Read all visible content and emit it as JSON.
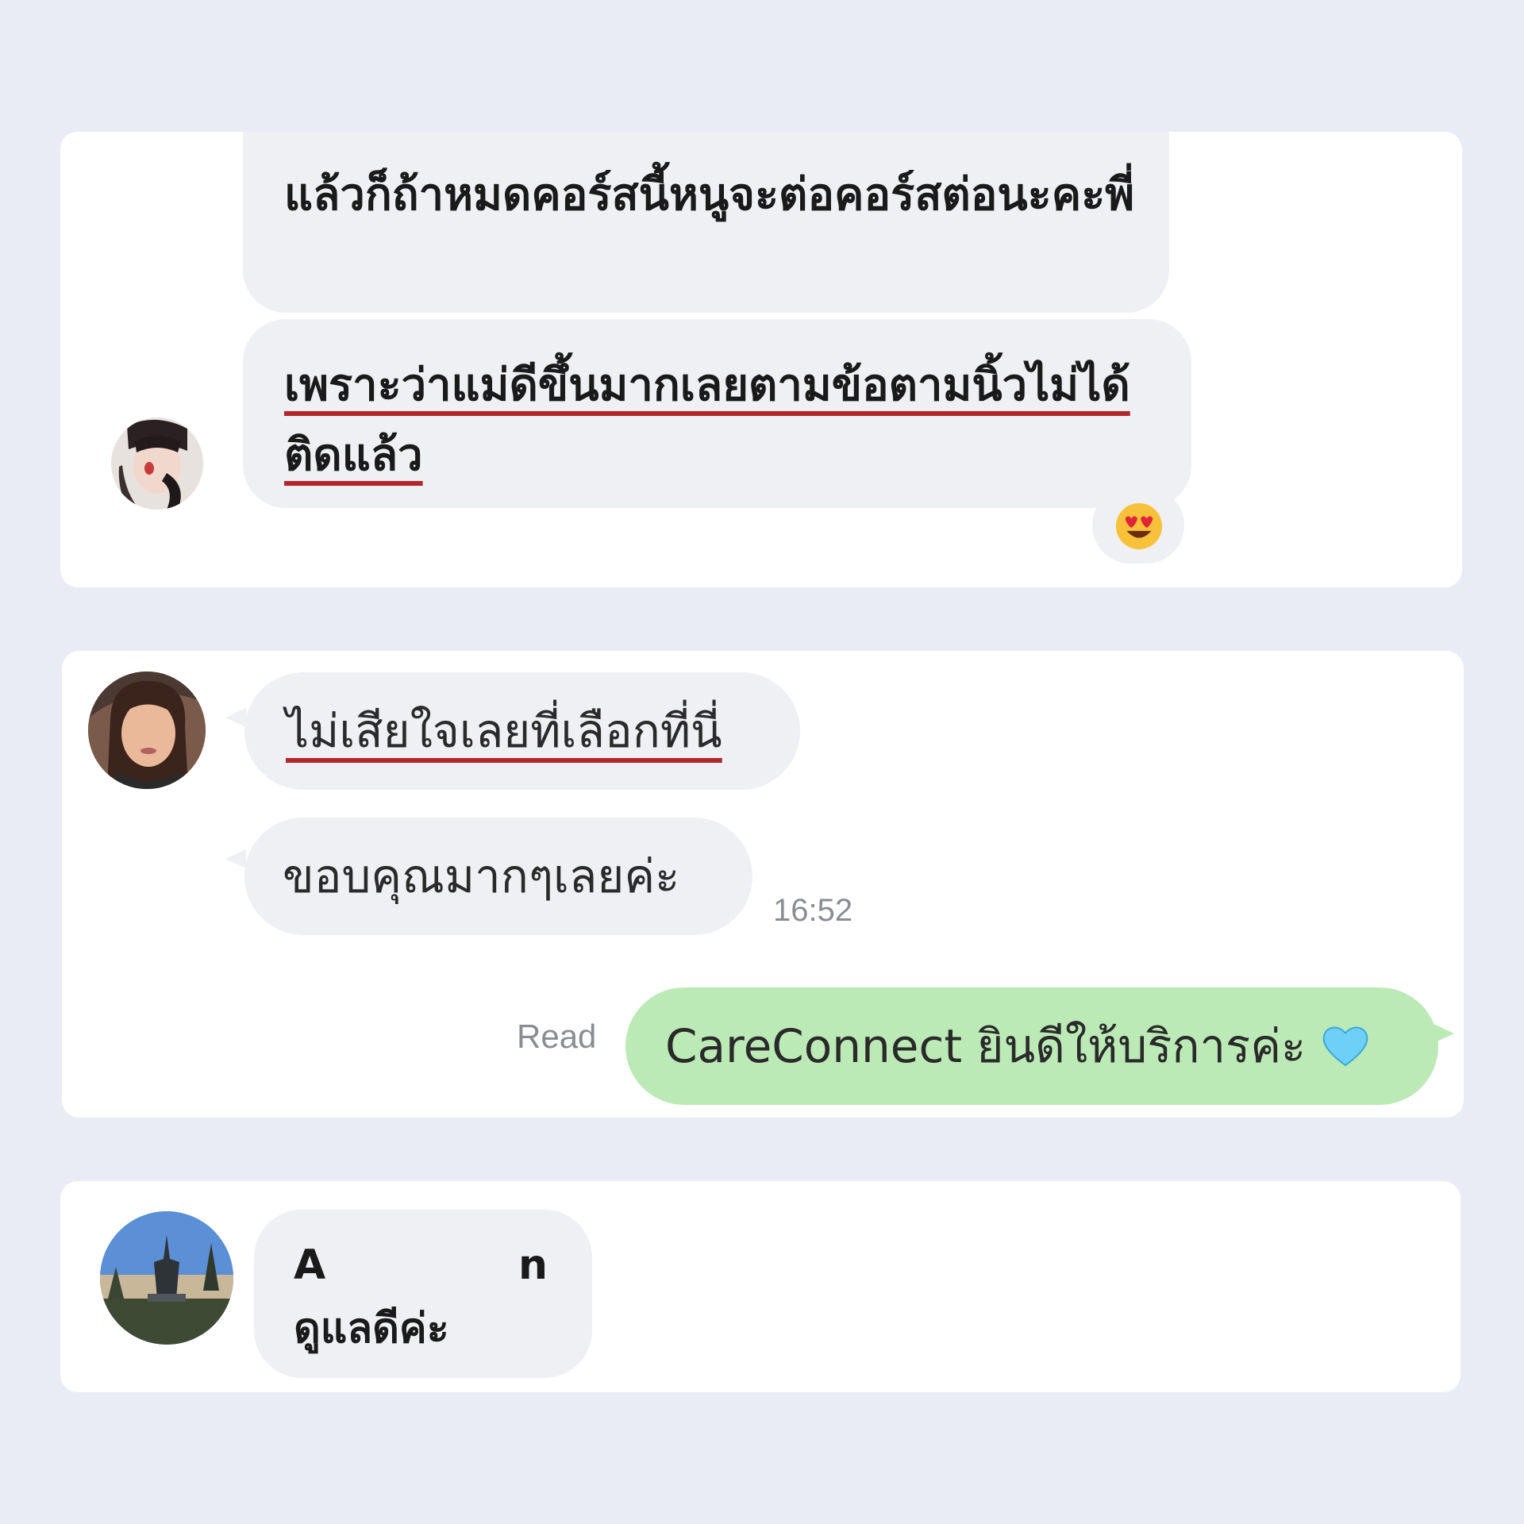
{
  "screenshot_1": {
    "messages": [
      "แล้วก็ถ้าหมดคอร์สนี้หนูจะต่อคอร์สต่อนะคะพี่",
      "เพราะว่าแม่ดีขึ้นมากเลยตามข้อตามนิ้วไม่ได้ติดแล้ว"
    ],
    "reaction_icon": "heart-eyes-emoji"
  },
  "screenshot_2": {
    "messages": [
      "ไม่เสียใจเลยที่เลือกที่นี่",
      "ขอบคุณมากๆเลยค่ะ"
    ],
    "timestamp": "16:52",
    "read_label": "Read",
    "reply": "CareConnect ยินดีให้บริการค่ะ",
    "reply_icon": "light-blue-heart-emoji"
  },
  "screenshot_3": {
    "name_initial": "A",
    "name_last": "n",
    "message": "ดูแลดีค่ะ"
  }
}
